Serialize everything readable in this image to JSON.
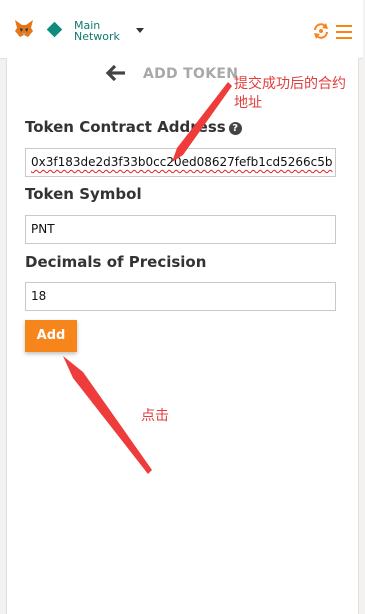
{
  "header": {
    "network_line1": "Main",
    "network_line2": "Network"
  },
  "page": {
    "title": "ADD TOKEN"
  },
  "form": {
    "contract_address_label": "Token Contract Address",
    "contract_address_value": "0x3f183de2d3f33b0cc20ed08627fefb1cd5266c5b",
    "token_symbol_label": "Token Symbol",
    "token_symbol_value": "PNT",
    "decimals_label": "Decimals of Precision",
    "decimals_value": "18",
    "add_button_label": "Add"
  },
  "annotations": {
    "contract_note_line1": "提交成功后的合约",
    "contract_note_line2": "地址",
    "click_note": "点击"
  },
  "colors": {
    "accent": "#f6851b",
    "network": "#0f8d7c",
    "annotation": "#e23d3d"
  }
}
